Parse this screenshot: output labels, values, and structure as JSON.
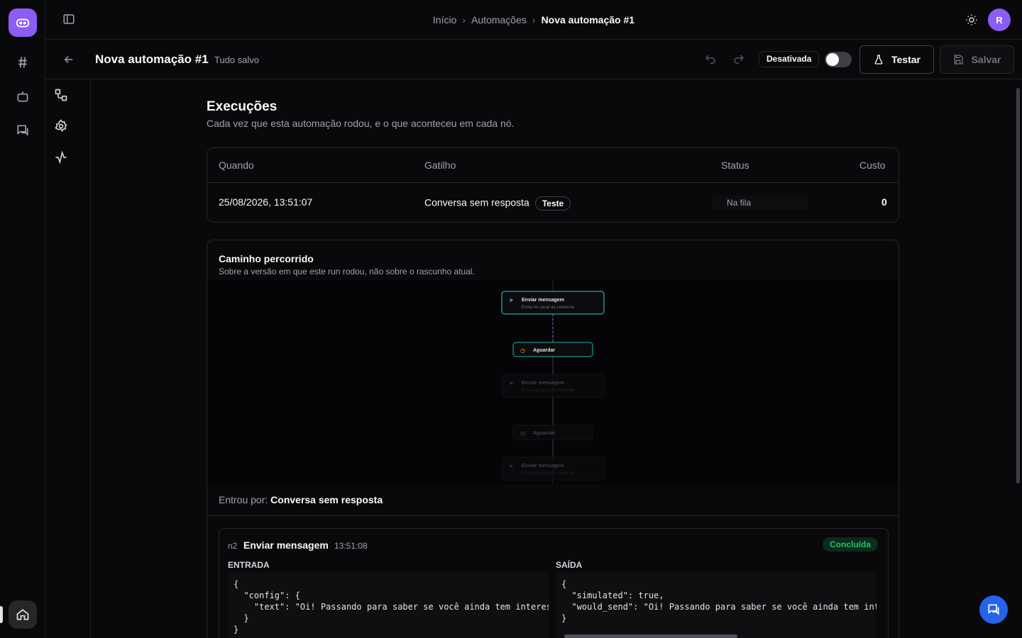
{
  "app": {
    "avatar_initial": "R",
    "brand_color": "#8b5cf6",
    "accent_blue": "#2563eb",
    "success_color": "#22c55e"
  },
  "breadcrumb": {
    "home": "Início",
    "section": "Automações",
    "current": "Nova automação #1"
  },
  "editor": {
    "title": "Nova automação #1",
    "save_state": "Tudo salvo",
    "status_label": "Desativada",
    "toggle_on": false,
    "test_label": "Testar",
    "save_label": "Salvar"
  },
  "executions": {
    "title": "Execuções",
    "subtitle": "Cada vez que esta automação rodou, e o que aconteceu em cada nó.",
    "columns": {
      "when": "Quando",
      "trigger": "Gatilho",
      "status": "Status",
      "cost": "Custo"
    },
    "rows": [
      {
        "when": "25/08/2026, 13:51:07",
        "trigger": "Conversa sem resposta",
        "badge": "Teste",
        "status": "Na fila",
        "cost": "0"
      }
    ]
  },
  "path": {
    "title": "Caminho percorrido",
    "subtitle": "Sobre a versão em que este run rodou, não sobre o rascunho atual.",
    "nodes": [
      {
        "label": "Enviar mensagem",
        "desc": "Envia no canal da conversa",
        "icon": "send-icon",
        "state": "done"
      },
      {
        "label": "Aguardar",
        "icon": "clock-icon",
        "state": "active"
      },
      {
        "label": "Enviar mensagem",
        "desc": "Envia no canal da conversa",
        "icon": "send-icon",
        "state": "pending"
      },
      {
        "label": "Aguardar",
        "icon": "clock-icon",
        "state": "pending"
      },
      {
        "label": "Enviar mensagem",
        "desc": "Envia no canal da conversa",
        "icon": "send-icon",
        "state": "pending"
      }
    ],
    "entered_label": "Entrou por:",
    "entered_value": "Conversa sem resposta"
  },
  "step": {
    "id": "n2",
    "name": "Enviar mensagem",
    "time": "13:51:08",
    "status": "Concluída",
    "input_label": "ENTRADA",
    "output_label": "SAÍDA",
    "input_json": "{\n  \"config\": {\n    \"text\": \"Oi! Passando para saber se você ainda tem interes\n  }\n}",
    "output_json": "{\n  \"simulated\": true,\n  \"would_send\": \"Oi! Passando para saber se você ainda tem int\n}"
  }
}
